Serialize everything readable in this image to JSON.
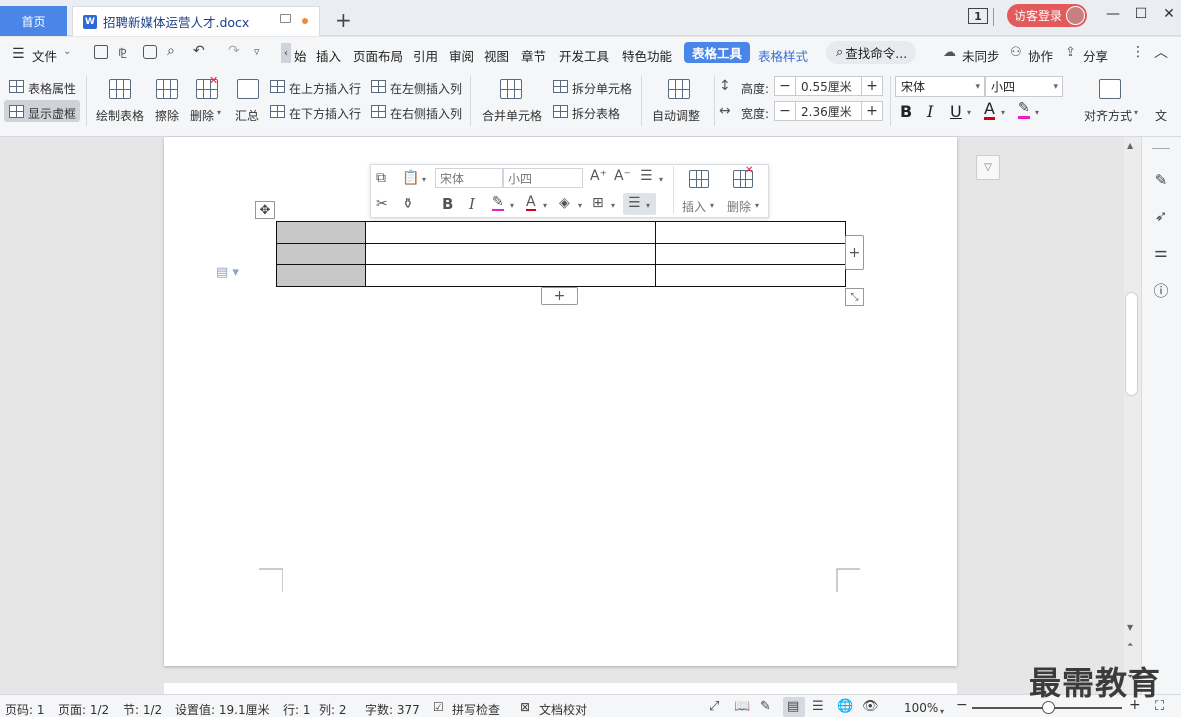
{
  "titlebar": {
    "home_tab": "首页",
    "doc_tab": "招聘新媒体运营人才.docx",
    "doc_icon_letter": "W",
    "new_tab": "+",
    "page_count_badge": "1",
    "login_label": "访客登录",
    "win_min": "—",
    "win_max": "☐",
    "win_close": "✕"
  },
  "menubar": {
    "file": "文件",
    "items": [
      "始",
      "插入",
      "页面布局",
      "引用",
      "审阅",
      "视图",
      "章节",
      "开发工具",
      "特色功能"
    ],
    "table_tools": "表格工具",
    "table_style": "表格样式",
    "search": "查找命令...",
    "unsynced": "未同步",
    "collab": "协作",
    "share": "分享"
  },
  "ribbon": {
    "table_props": "表格属性",
    "show_gridlines": "显示虚框",
    "draw_table": "绘制表格",
    "erase": "擦除",
    "delete": "删除",
    "summary": "汇总",
    "insert_above": "在上方插入行",
    "insert_below": "在下方插入行",
    "insert_left": "在左侧插入列",
    "insert_right": "在右侧插入列",
    "merge_cells": "合并单元格",
    "split_cells": "拆分单元格",
    "split_table": "拆分表格",
    "auto_fit": "自动调整",
    "height_label": "高度:",
    "height_value": "0.55厘米",
    "width_label": "宽度:",
    "width_value": "2.36厘米",
    "font_name": "宋体",
    "font_size": "小四",
    "bold": "B",
    "italic": "I",
    "underline": "U",
    "font_color": "A",
    "align": "对齐方式",
    "text_dir": "文"
  },
  "float_toolbar": {
    "font_name": "宋体",
    "font_size": "小四",
    "insert": "插入",
    "delete": "删除"
  },
  "table": {
    "rows": 3,
    "cols": 3,
    "header_col_fill": "#c8c8c8"
  },
  "statusbar": {
    "page_no": "页码: 1",
    "pages": "页面: 1/2",
    "section": "节: 1/2",
    "setting": "设置值: 19.1厘米",
    "row": "行: 1",
    "col": "列: 2",
    "words": "字数: 377",
    "spell": "拼写检查",
    "proof": "文档校对",
    "zoom": "100%"
  },
  "watermark": "最需教育",
  "colors": {
    "accent": "#4a86e8",
    "login": "#e25a5a"
  }
}
